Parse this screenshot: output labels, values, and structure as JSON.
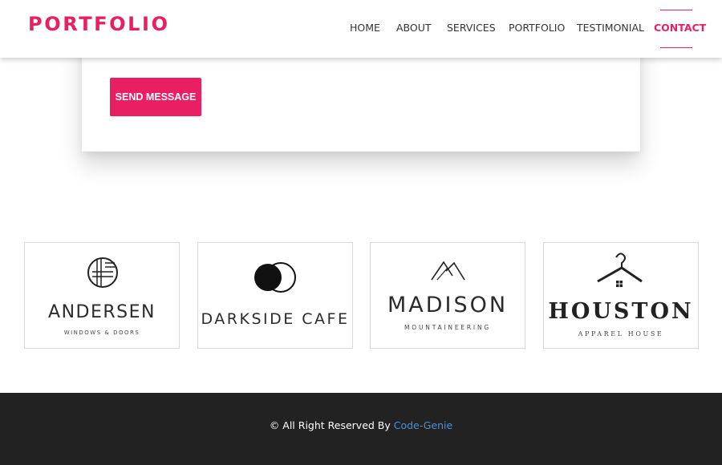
{
  "brand": {
    "name": "PORTFOLIO",
    "color": "#e91e63"
  },
  "nav": {
    "items": [
      {
        "label": "HOME"
      },
      {
        "label": "ABOUT"
      },
      {
        "label": "SERVICES"
      },
      {
        "label": "PORTFOLIO"
      },
      {
        "label": "TESTIMONIAL"
      },
      {
        "label": "CONTACT",
        "active": true
      }
    ]
  },
  "contact": {
    "send_label": "SEND MESSAGE"
  },
  "clients": [
    {
      "name": "ANDERSEN",
      "tagline": "WINDOWS & DOORS",
      "icon": "striped-circle-icon"
    },
    {
      "name": "DARKSIDE CAFE",
      "tagline": "",
      "icon": "overlapping-circles-icon"
    },
    {
      "name": "MADISON",
      "tagline": "MOUNTAINEERING",
      "icon": "mountain-peaks-icon"
    },
    {
      "name": "HOUSTON",
      "tagline": "APPAREL HOUSE",
      "icon": "clothes-hanger-icon"
    }
  ],
  "footer": {
    "text": "© All Right Reserved By ",
    "link_label": "Code-Genie"
  },
  "colors": {
    "accent": "#e91e63",
    "footer_bg": "#222222",
    "link": "#4a90d9"
  }
}
